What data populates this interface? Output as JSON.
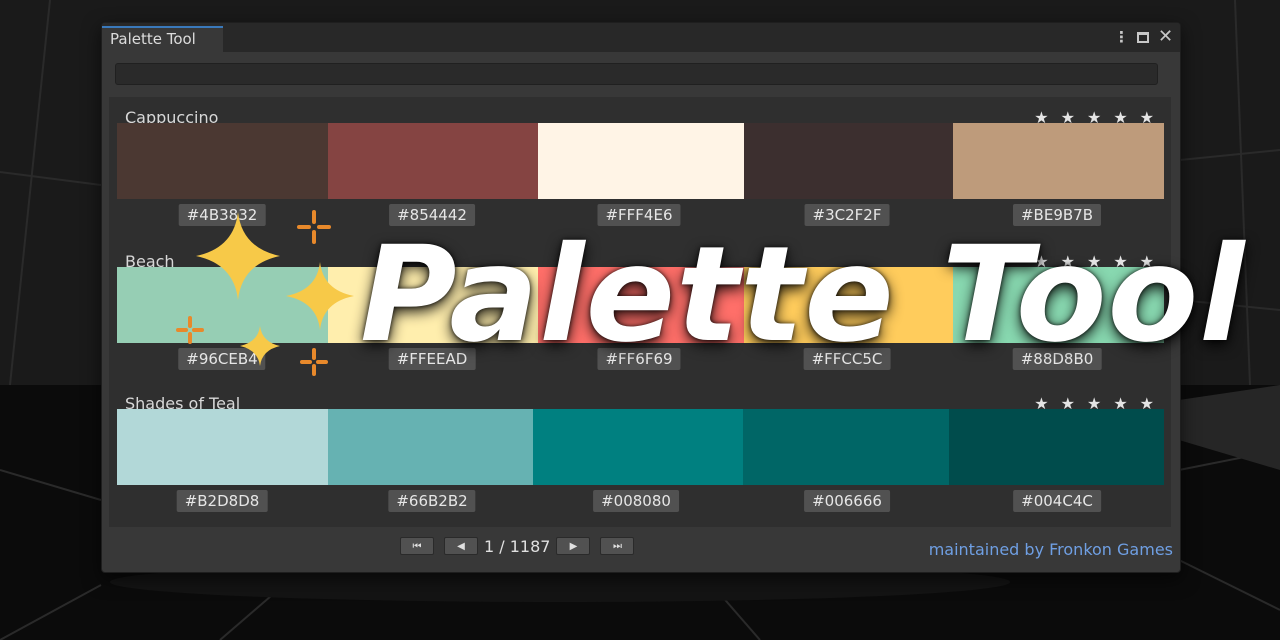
{
  "window": {
    "tab_title": "Palette Tool",
    "controls": {
      "more": "⋮",
      "close": "✕"
    }
  },
  "search": {
    "value": "",
    "placeholder": ""
  },
  "palettes": [
    {
      "name": "Cappuccino",
      "stars": [
        "★",
        "★",
        "★",
        "★",
        "★"
      ],
      "colors": [
        "#4B3832",
        "#854442",
        "#FFF4E6",
        "#3C2F2F",
        "#BE9B7B"
      ],
      "hex_labels": [
        "#4B3832",
        "#854442",
        "#FFF4E6",
        "#3C2F2F",
        "#BE9B7B"
      ]
    },
    {
      "name": "Beach",
      "stars": [
        "★",
        "★",
        "★",
        "★",
        "★"
      ],
      "colors": [
        "#96CEB4",
        "#FFEEAD",
        "#FF6F69",
        "#FFCC5C",
        "#88D8B0"
      ],
      "hex_labels": [
        "#96CEB4",
        "#FFEEAD",
        "#FF6F69",
        "#FFCC5C",
        "#88D8B0"
      ]
    },
    {
      "name": "Shades of Teal",
      "stars": [
        "★",
        "★",
        "★",
        "★",
        "★"
      ],
      "colors": [
        "#B2D8D8",
        "#66B2B2",
        "#008080",
        "#006666",
        "#004C4C"
      ],
      "hex_labels": [
        "#B2D8D8",
        "#66B2B2",
        "#008080",
        "#006666",
        "#004C4C"
      ]
    }
  ],
  "pager": {
    "first_icon": "⏮",
    "prev_icon": "◀",
    "next_icon": "▶",
    "last_icon": "⏭",
    "count": "1 / 1187"
  },
  "footer": {
    "maintainer": "maintained by Fronkon Games"
  },
  "overlay": {
    "title": "Palette Tool"
  },
  "accent_colors": {
    "tab_highlight": "#3A79BB",
    "link": "#6F9FE3",
    "sparkle_yellow": "#F7C948",
    "sparkle_orange": "#E8892B"
  }
}
